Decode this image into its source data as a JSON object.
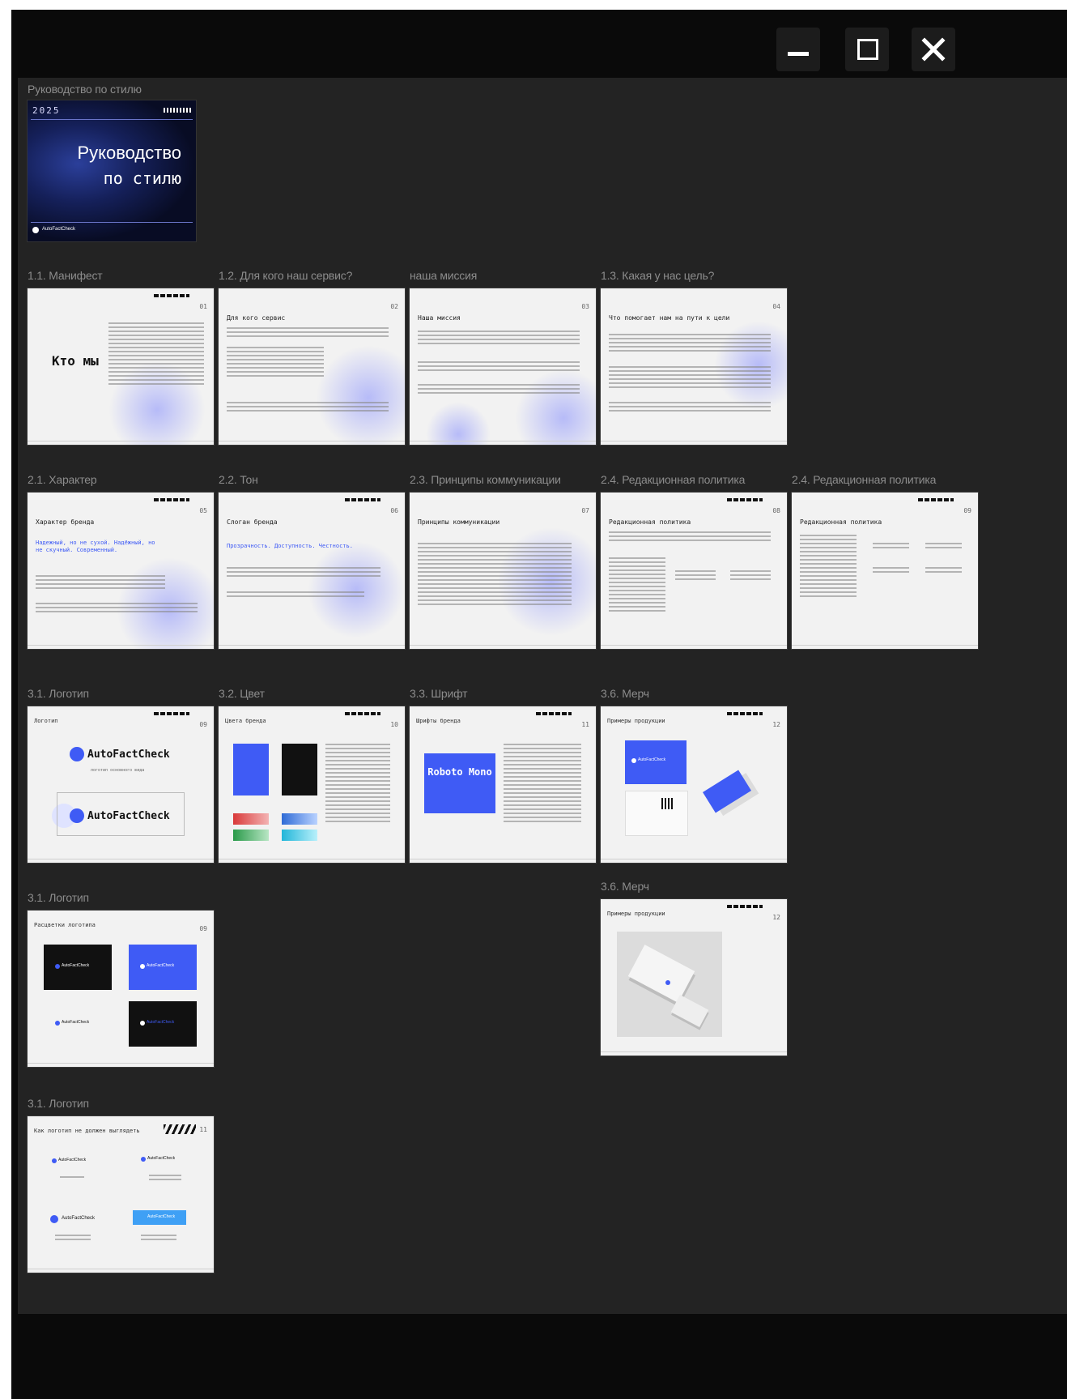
{
  "window": {
    "controls": {
      "minimize_icon": "minimize-icon",
      "maximize_icon": "maximize-icon",
      "close_icon": "close-icon"
    }
  },
  "cover": {
    "label": "Руководство по стилю",
    "year": "2025",
    "title_line1": "Руководство",
    "title_line2": "по стилю",
    "brand": "AutoFactCheck"
  },
  "sections": {
    "s1_1": "1.1. Манифест",
    "s1_2": "1.2. Для кого наш сервис?",
    "s_mission": "наша миссия",
    "s1_3": "1.3. Какая у нас цель?",
    "s2_1": "2.1. Характер",
    "s2_2": "2.2. Тон",
    "s2_3": "2.3. Принципы коммуникации",
    "s2_4a": "2.4. Редакционная политика",
    "s2_4b": "2.4. Редакционная политика",
    "s3_1a": "3.1. Логотип",
    "s3_2": "3.2. Цвет",
    "s3_3": "3.3. Шрифт",
    "s3_6a": "3.6. Мерч",
    "s3_1b": "3.1. Логотип",
    "s3_6b": "3.6. Мерч",
    "s3_1c": "3.1. Логотип"
  },
  "slides": {
    "manifest": {
      "num": "01",
      "title": "Кто мы"
    },
    "audience": {
      "num": "02",
      "heading": "Для кого сервис"
    },
    "mission": {
      "num": "03",
      "heading": "Наша миссия"
    },
    "goal": {
      "num": "04",
      "heading": "Что помогает нам на пути к цели"
    },
    "character": {
      "num": "05",
      "heading": "Характер бренда",
      "tagline": "Надежный, но не сухой. Надёжный, но не скучный. Современный."
    },
    "tone": {
      "num": "06",
      "heading": "Слоган бренда",
      "tagline": "Прозрачность. Доступность. Честность."
    },
    "principles": {
      "num": "07",
      "heading": "Принципы коммуникации"
    },
    "editorial1": {
      "num": "08",
      "heading": "Редакционная политика"
    },
    "editorial2": {
      "num": "09",
      "heading": "Редакционная политика"
    },
    "logo1": {
      "num": "09",
      "heading": "Логотип",
      "brand": "AutoFactCheck",
      "caption": "логотип основного вида"
    },
    "color": {
      "num": "10",
      "heading": "Цвета бренда"
    },
    "font": {
      "num": "11",
      "heading": "Шрифты бренда",
      "font_name": "Roboto Mono"
    },
    "merch1": {
      "num": "12",
      "heading": "Примеры продукции",
      "brand": "AutoFactCheck"
    },
    "logo2": {
      "num": "09",
      "heading": "Расцветки логотипа",
      "brand": "AutoFactCheck"
    },
    "merch2": {
      "num": "12",
      "heading": "Примеры продукции"
    },
    "logo3": {
      "num": "11",
      "heading": "Как логотип не должен выглядеть",
      "brand": "AutoFactCheck"
    }
  },
  "colors": {
    "accent": "#3f5bf5",
    "canvas": "#232323",
    "titlebar": "#0a0a0a",
    "slide_bg": "#f2f2f2"
  }
}
